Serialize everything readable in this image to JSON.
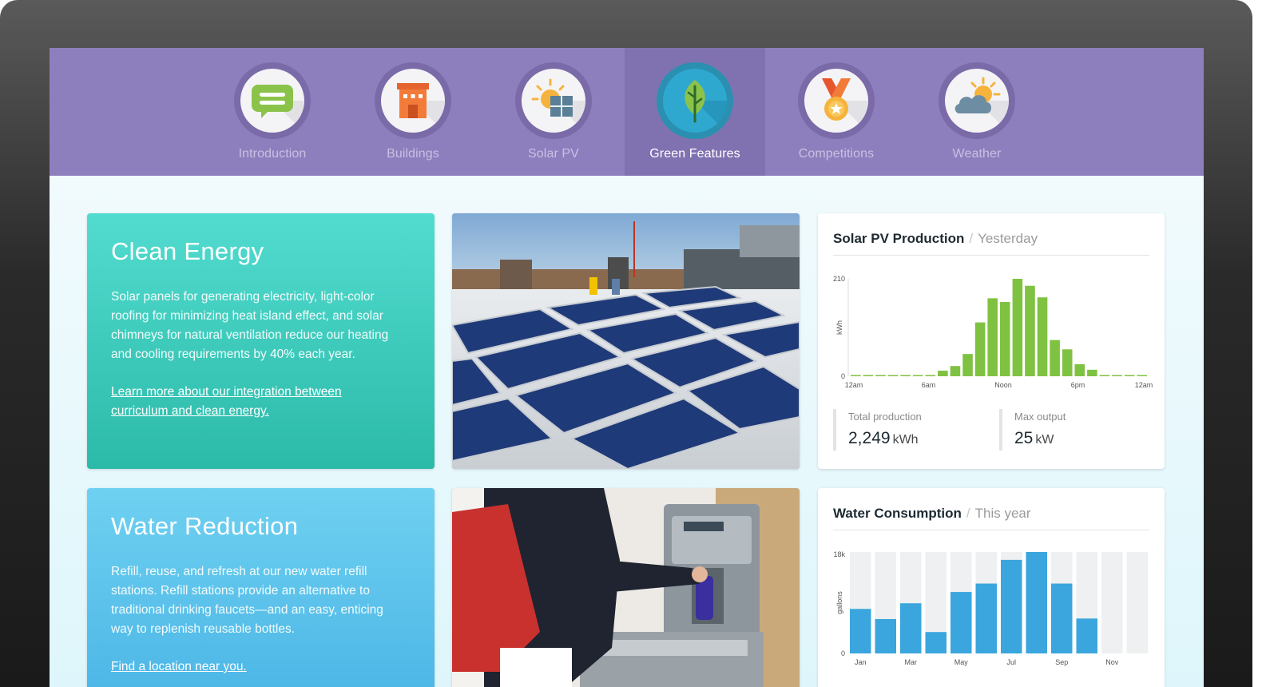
{
  "nav": {
    "tabs": [
      {
        "label": "Introduction",
        "icon": "chat-bubble-icon",
        "active": false
      },
      {
        "label": "Buildings",
        "icon": "building-icon",
        "active": false
      },
      {
        "label": "Solar PV",
        "icon": "solar-panel-icon",
        "active": false
      },
      {
        "label": "Green Features",
        "icon": "leaf-icon",
        "active": true
      },
      {
        "label": "Competitions",
        "icon": "medal-icon",
        "active": false
      },
      {
        "label": "Weather",
        "icon": "partly-cloudy-icon",
        "active": false
      }
    ]
  },
  "clean_energy": {
    "title": "Clean Energy",
    "body": "Solar panels for generating electricity, light-color roofing for minimizing heat island effect, and solar chimneys for natural ventilation reduce our heating and cooling requirements by 40% each year.",
    "link": "Learn more about our integration between curriculum and clean energy."
  },
  "water_reduction": {
    "title": "Water Reduction",
    "body": "Refill, reuse, and refresh at our new water refill stations. Refill stations provide an alternative to traditional drinking faucets—and an easy, enticing way to replenish reusable bottles.",
    "link": "Find a location near you."
  },
  "solar_chart": {
    "title": "Solar PV Production",
    "separator": "/",
    "subtitle": "Yesterday",
    "stats": [
      {
        "label": "Total production",
        "value": "2,249",
        "unit": "kWh"
      },
      {
        "label": "Max output",
        "value": "25",
        "unit": "kW"
      }
    ]
  },
  "water_chart": {
    "title": "Water Consumption",
    "separator": "/",
    "subtitle": "This year"
  },
  "colors": {
    "nav_bg": "#8d7fbd",
    "solar_bar": "#7fc241",
    "water_bar": "#3aa6dd",
    "water_bar_bg": "#eef0f1",
    "clean_card": "#3ecbbb",
    "water_card": "#5cc2ec"
  },
  "chart_data": [
    {
      "type": "bar",
      "title": "Solar PV Production",
      "ylabel": "kWh",
      "yticks": [
        "0",
        "210"
      ],
      "ylim": [
        0,
        210
      ],
      "xticks": [
        "12am",
        "6am",
        "Noon",
        "6pm",
        "12am"
      ],
      "categories": [
        "0",
        "1",
        "2",
        "3",
        "4",
        "5",
        "6",
        "7",
        "8",
        "9",
        "10",
        "11",
        "12",
        "13",
        "14",
        "15",
        "16",
        "17",
        "18",
        "19",
        "20",
        "21",
        "22",
        "23"
      ],
      "values": [
        0,
        0,
        0,
        0,
        0,
        0,
        0,
        12,
        22,
        48,
        116,
        168,
        160,
        210,
        195,
        170,
        78,
        58,
        26,
        14,
        0,
        0,
        0,
        0
      ]
    },
    {
      "type": "bar",
      "title": "Water Consumption",
      "ylabel": "gallons",
      "yticks": [
        "0",
        "18k"
      ],
      "ylim": [
        0,
        18000
      ],
      "xticks": [
        "Jan",
        "Mar",
        "May",
        "Jul",
        "Sep",
        "Nov"
      ],
      "categories": [
        "Jan",
        "Feb",
        "Mar",
        "Apr",
        "May",
        "Jun",
        "Jul",
        "Aug",
        "Sep",
        "Oct",
        "Nov",
        "Dec"
      ],
      "values": [
        7900,
        6100,
        8900,
        3800,
        10900,
        12400,
        16600,
        18000,
        12400,
        6200,
        0,
        0
      ]
    }
  ]
}
